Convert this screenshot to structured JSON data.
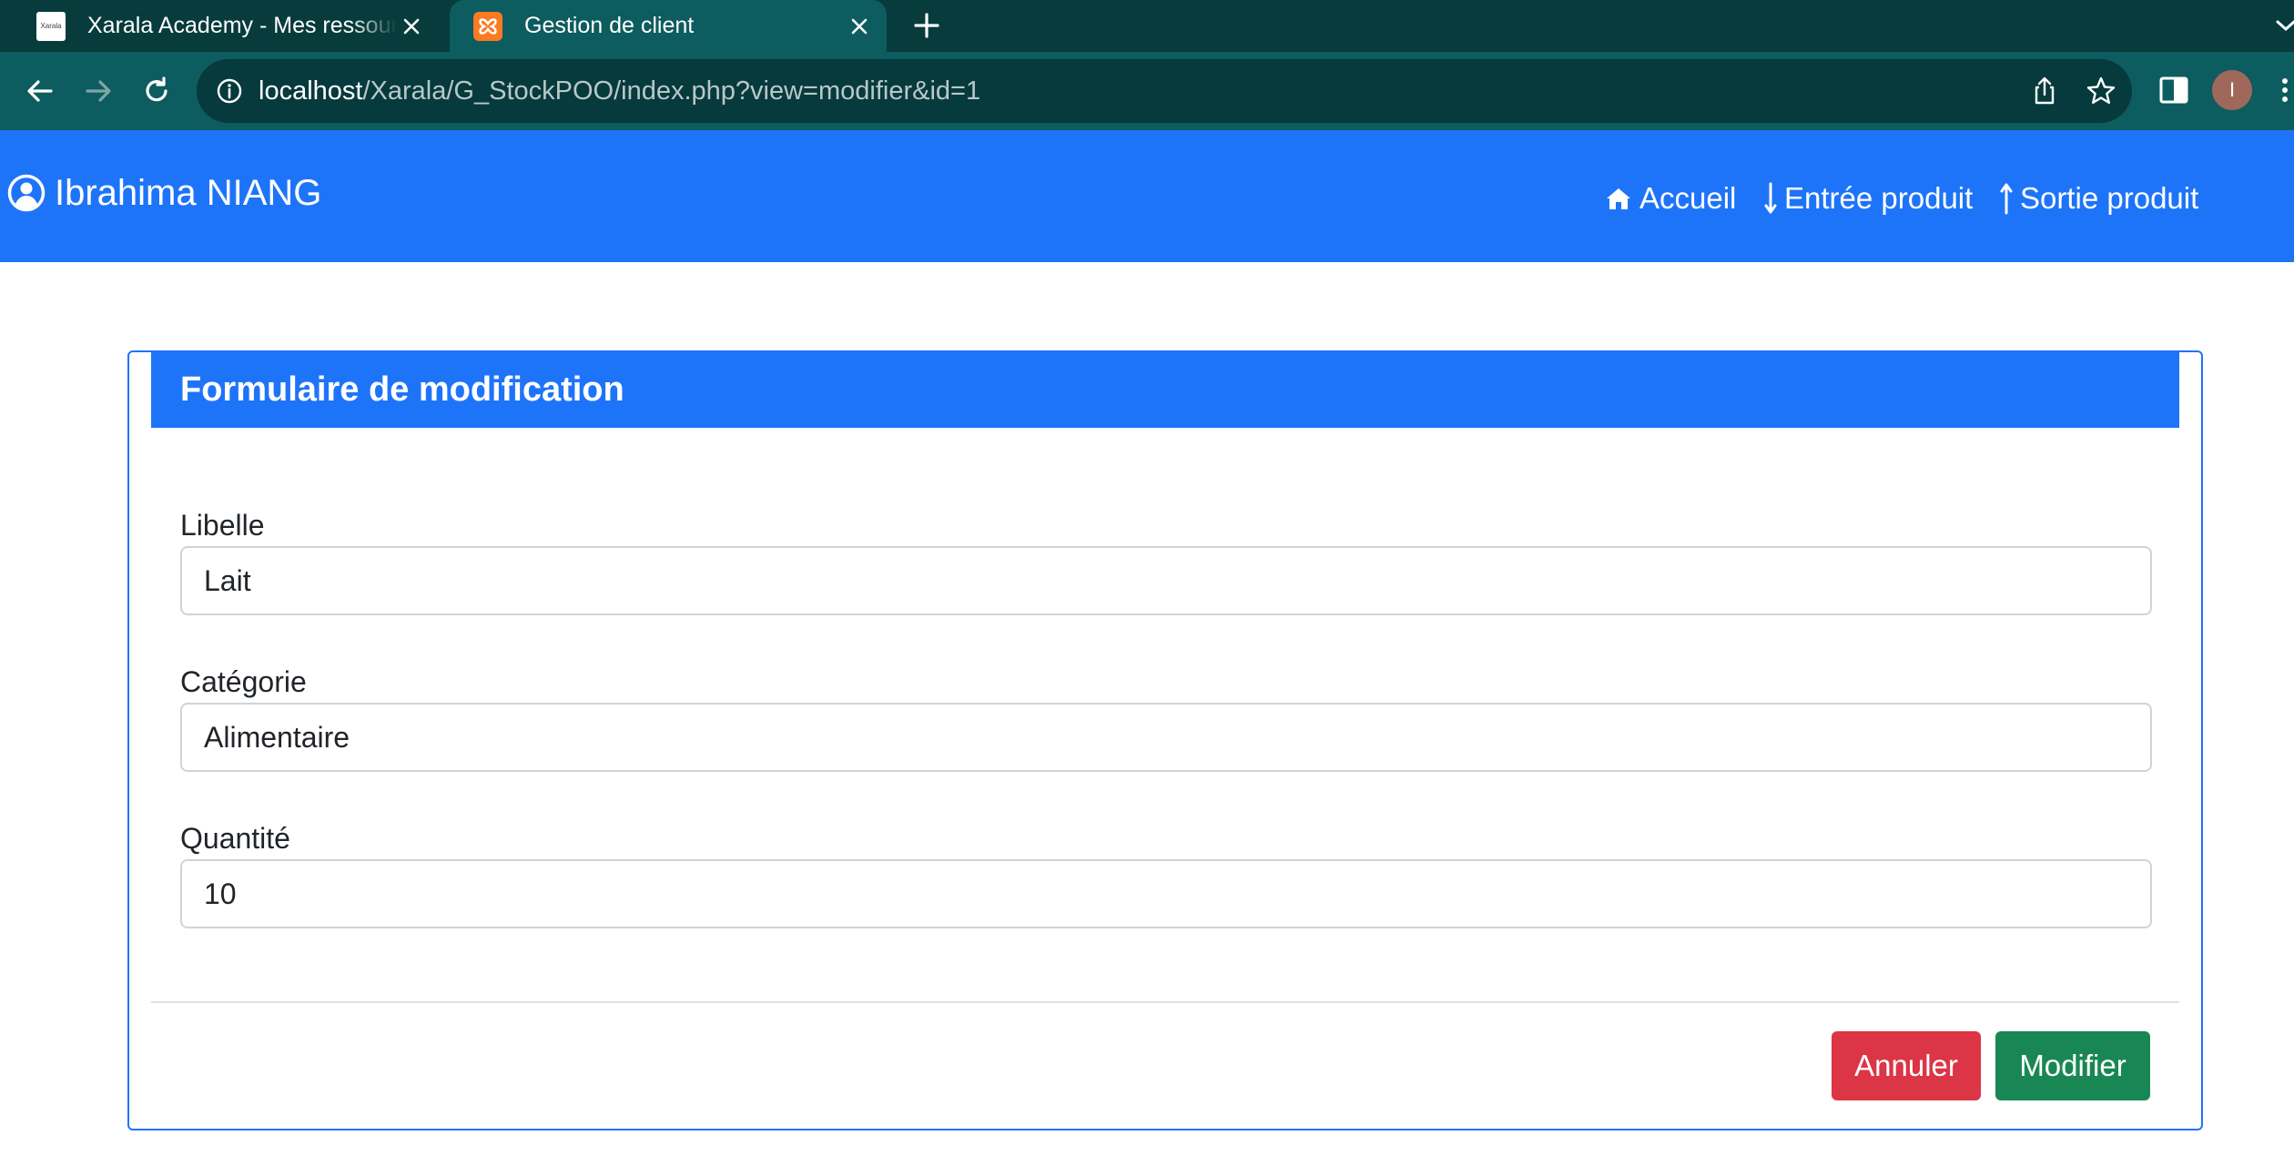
{
  "browser": {
    "tabs": [
      {
        "title": "Xarala Academy - Mes ressources",
        "favicon_text": "Xarala",
        "active": false
      },
      {
        "title": "Gestion de client",
        "active": true
      }
    ],
    "url_host": "localhost",
    "url_path": "/Xarala/G_StockPOO/index.php?view=modifier&id=1",
    "profile_initial": "I"
  },
  "navbar": {
    "brand": "Ibrahima NIANG",
    "links": [
      {
        "label": "Accueil",
        "icon": "home-icon"
      },
      {
        "label": "Entrée produit",
        "icon": "arrow-down-icon"
      },
      {
        "label": "Sortie produit",
        "icon": "arrow-up-icon"
      }
    ]
  },
  "form": {
    "title": "Formulaire de modification",
    "fields": [
      {
        "label": "Libelle",
        "value": "Lait"
      },
      {
        "label": "Catégorie",
        "value": "Alimentaire"
      },
      {
        "label": "Quantité",
        "value": "10"
      }
    ],
    "cancel_label": "Annuler",
    "submit_label": "Modifier"
  },
  "colors": {
    "primary": "#1e74f9",
    "danger": "#dc3545",
    "success": "#198754",
    "browser_frame": "#0d5c5f"
  }
}
